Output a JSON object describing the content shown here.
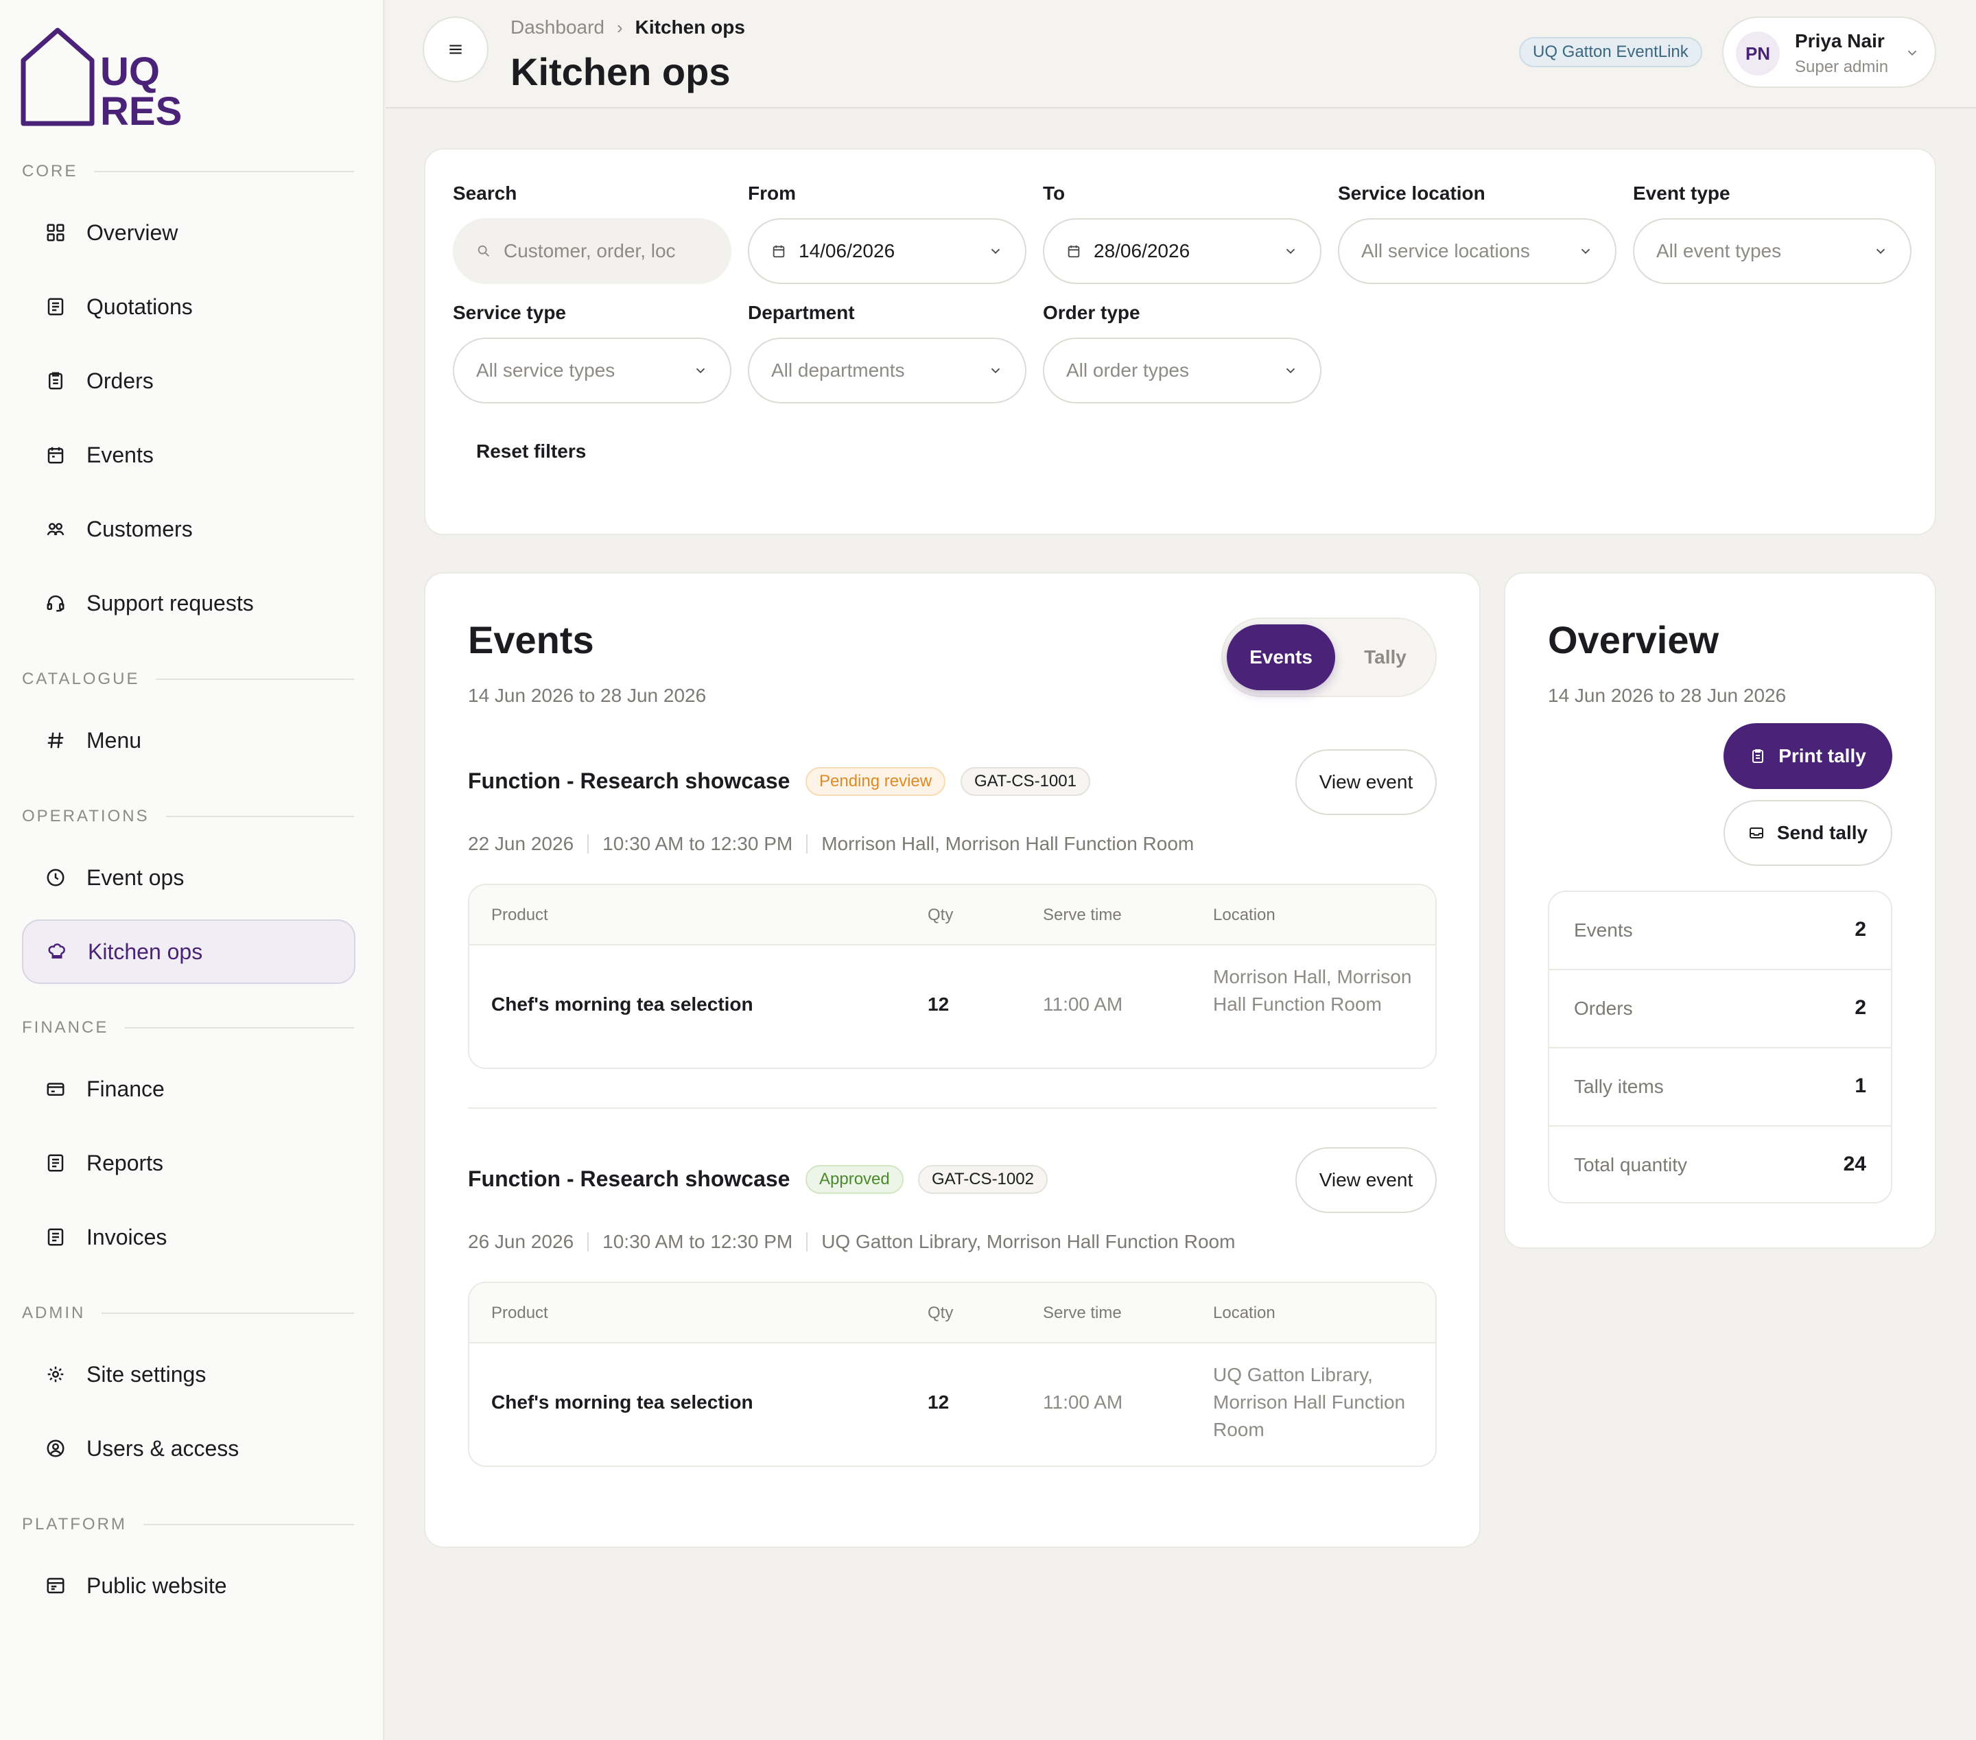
{
  "brand": {
    "logo_line1": "UQ",
    "logo_line2": "RES",
    "color_primary": "#4a2277"
  },
  "sidebar": {
    "sections": [
      {
        "label": "CORE"
      },
      {
        "label": "CATALOGUE"
      },
      {
        "label": "OPERATIONS"
      },
      {
        "label": "FINANCE"
      },
      {
        "label": "ADMIN"
      },
      {
        "label": "PLATFORM"
      }
    ],
    "items": [
      {
        "label": "Overview",
        "icon": "grid-icon"
      },
      {
        "label": "Quotations",
        "icon": "document-icon"
      },
      {
        "label": "Orders",
        "icon": "clipboard-icon"
      },
      {
        "label": "Events",
        "icon": "calendar-icon"
      },
      {
        "label": "Customers",
        "icon": "users-icon"
      },
      {
        "label": "Support requests",
        "icon": "headset-icon"
      },
      {
        "label": "Menu",
        "icon": "hash-icon"
      },
      {
        "label": "Event ops",
        "icon": "clock-icon"
      },
      {
        "label": "Kitchen ops",
        "icon": "chef-hat-icon",
        "active": true
      },
      {
        "label": "Finance",
        "icon": "card-icon"
      },
      {
        "label": "Reports",
        "icon": "report-icon"
      },
      {
        "label": "Invoices",
        "icon": "invoice-icon"
      },
      {
        "label": "Site settings",
        "icon": "gear-icon"
      },
      {
        "label": "Users & access",
        "icon": "user-circle-icon"
      },
      {
        "label": "Public website",
        "icon": "browser-icon"
      }
    ]
  },
  "header": {
    "breadcrumb": [
      "Dashboard",
      "Kitchen ops"
    ],
    "title": "Kitchen ops",
    "tenant": "UQ Gatton EventLink",
    "user": {
      "initials": "PN",
      "name": "Priya Nair",
      "role": "Super admin"
    }
  },
  "filters": {
    "search": {
      "label": "Search",
      "placeholder": "Customer, order, loc"
    },
    "from": {
      "label": "From",
      "value": "14/06/2026"
    },
    "to": {
      "label": "To",
      "value": "28/06/2026"
    },
    "service_location": {
      "label": "Service location",
      "value": "All service locations"
    },
    "event_type": {
      "label": "Event type",
      "value": "All event types"
    },
    "service_type": {
      "label": "Service type",
      "value": "All service types"
    },
    "department": {
      "label": "Department",
      "value": "All departments"
    },
    "order_type": {
      "label": "Order type",
      "value": "All order types"
    },
    "reset": "Reset filters"
  },
  "events_panel": {
    "title": "Events",
    "range": "14 Jun 2026 to 28 Jun 2026",
    "toggle": {
      "on": "Events",
      "off": "Tally"
    },
    "view_label": "View event",
    "table_headers": {
      "product": "Product",
      "qty": "Qty",
      "serve_time": "Serve time",
      "location": "Location"
    },
    "events": [
      {
        "title": "Function - Research showcase",
        "status": "Pending review",
        "code": "GAT-CS-1001",
        "date": "22 Jun 2026",
        "time": "10:30 AM to 12:30 PM",
        "venue": "Morrison Hall, Morrison Hall Function Room",
        "row": {
          "product": "Chef's morning tea selection",
          "qty": "12",
          "serve_time": "11:00 AM",
          "location": "Morrison Hall, Morrison Hall Function Room"
        }
      },
      {
        "title": "Function - Research showcase",
        "status": "Approved",
        "code": "GAT-CS-1002",
        "date": "26 Jun 2026",
        "time": "10:30 AM to 12:30 PM",
        "venue": "UQ Gatton Library, Morrison Hall Function Room",
        "row": {
          "product": "Chef's morning tea selection",
          "qty": "12",
          "serve_time": "11:00 AM",
          "location": "UQ Gatton Library, Morrison Hall Function Room"
        }
      }
    ]
  },
  "overview": {
    "title": "Overview",
    "range": "14 Jun 2026 to 28 Jun 2026",
    "print_label": "Print tally",
    "send_label": "Send tally",
    "stats": [
      {
        "label": "Events",
        "value": "2"
      },
      {
        "label": "Orders",
        "value": "2"
      },
      {
        "label": "Tally items",
        "value": "1"
      },
      {
        "label": "Total quantity",
        "value": "24"
      }
    ]
  }
}
